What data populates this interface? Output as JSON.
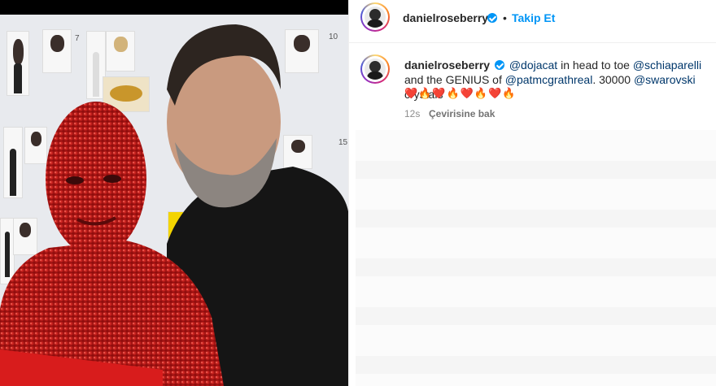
{
  "post": {
    "photo_alt": "",
    "board_numbers": [
      "7",
      "10",
      "15"
    ]
  },
  "header": {
    "username": "danielroseberry",
    "separator": "•",
    "follow_label": "Takip Et"
  },
  "comment": {
    "username": "danielroseberry",
    "caption_parts": {
      "mention1": "@dojacat",
      "text1": " in head to toe ",
      "mention2": "@schiaparelli",
      "text2": " and the GENIUS of ",
      "mention3": "@patmcgrathreal",
      "text3": ". 30000 ",
      "mention4": "@swarovski",
      "text4": " crystals"
    },
    "emojis": "❤️🔥❤️🔥❤️🔥❤️🔥",
    "time": "12s",
    "translate_label": "Çevirisine bak"
  }
}
